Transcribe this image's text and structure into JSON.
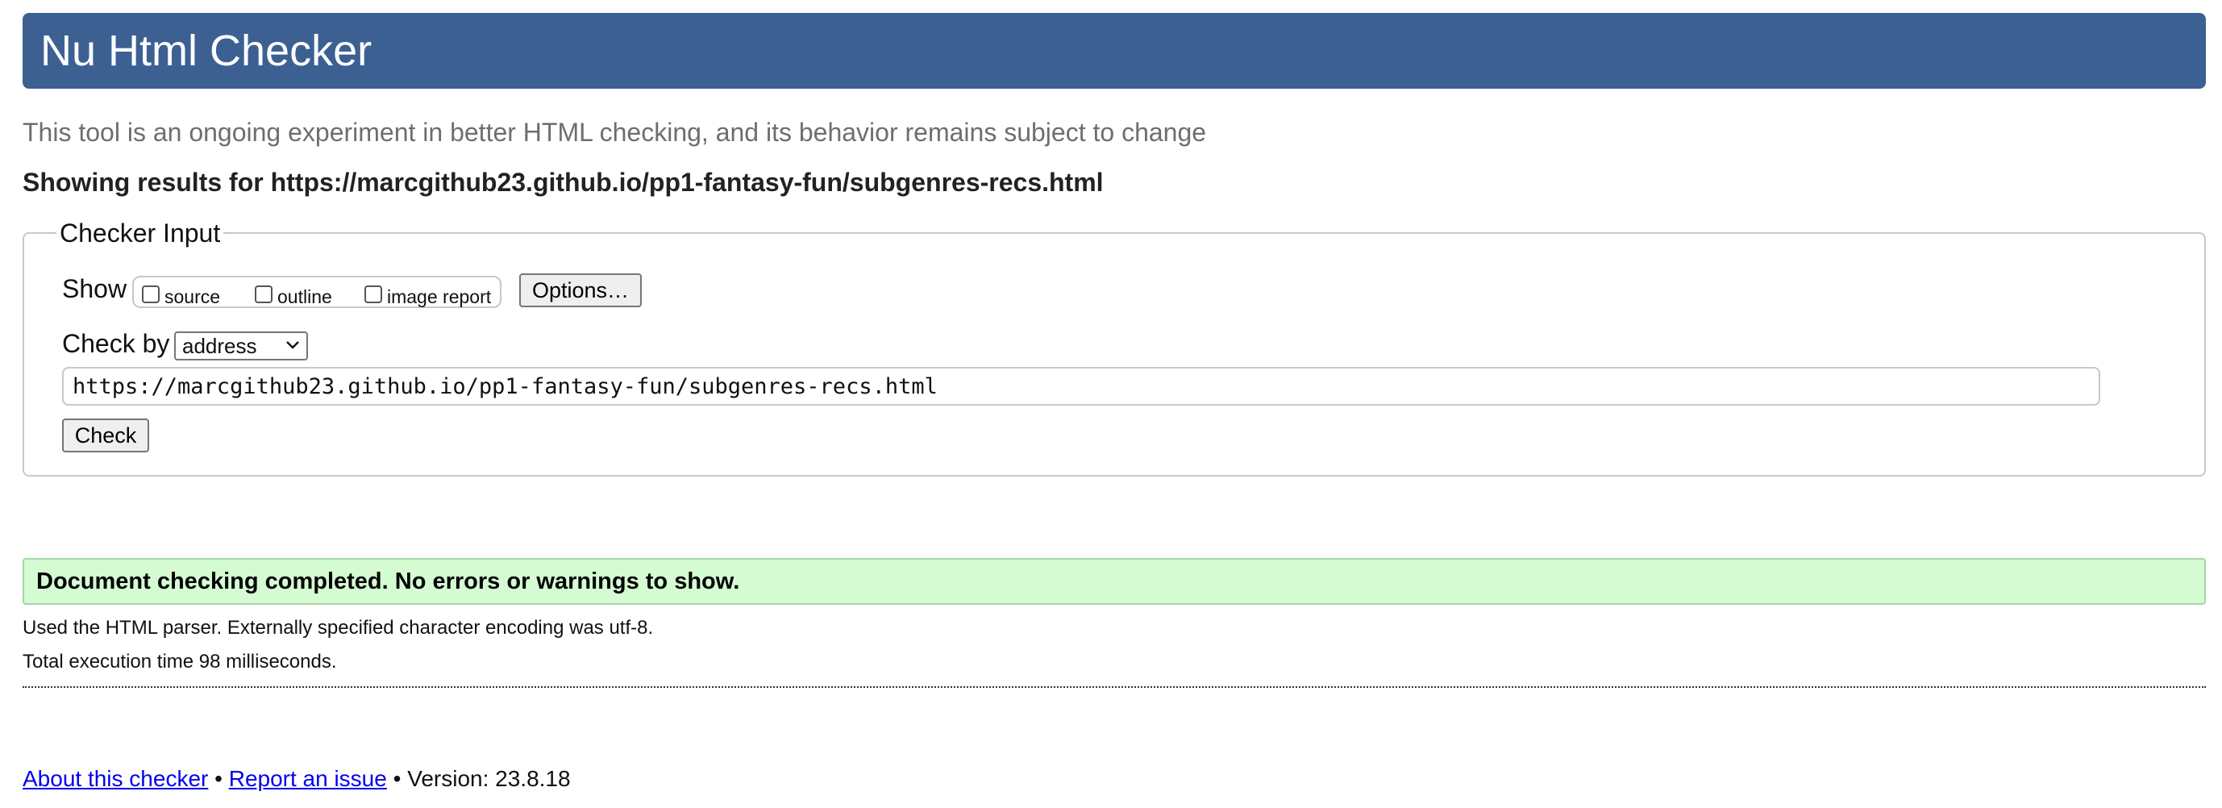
{
  "header": {
    "title": "Nu Html Checker"
  },
  "tagline": "This tool is an ongoing experiment in better HTML checking, and its behavior remains subject to change",
  "results_heading": "Showing results for https://marcgithub23.github.io/pp1-fantasy-fun/subgenres-recs.html",
  "checker_input": {
    "legend": "Checker Input",
    "show_label": "Show",
    "show_options": [
      {
        "label": "source",
        "checked": false
      },
      {
        "label": "outline",
        "checked": false
      },
      {
        "label": "image report",
        "checked": false
      }
    ],
    "options_button": "Options…",
    "check_by_label": "Check by",
    "check_by_value": "address",
    "url_value": "https://marcgithub23.github.io/pp1-fantasy-fun/subgenres-recs.html",
    "check_button": "Check"
  },
  "result": {
    "message": "Document checking completed. No errors or warnings to show.",
    "status_color": "#d5fbd3"
  },
  "info": {
    "parser_line": "Used the HTML parser. Externally specified character encoding was utf-8.",
    "time_line": "Total execution time 98 milliseconds."
  },
  "footer": {
    "about_link": "About this checker",
    "separator": "•",
    "report_link": "Report an issue",
    "version": "Version: 23.8.18"
  },
  "colors": {
    "banner": "#3d6093",
    "link": "#0000ee"
  }
}
